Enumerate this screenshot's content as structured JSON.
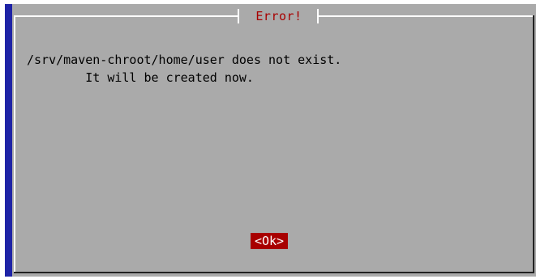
{
  "dialog": {
    "title": "Error!",
    "message_line1": "/srv/maven-chroot/home/user does not exist.",
    "message_line2": "        It will be created now.",
    "ok_label": "<Ok>"
  },
  "colors": {
    "background": "#ffffff",
    "desktop_blue": "#1e23a6",
    "dialog_gray": "#aaaaaa",
    "title_red": "#a80000",
    "button_red": "#a80000",
    "button_text": "#ffffff"
  }
}
